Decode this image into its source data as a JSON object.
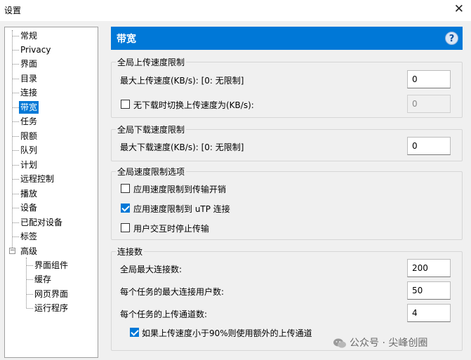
{
  "window": {
    "title": "设置",
    "close_glyph": "✕"
  },
  "tree": {
    "items": [
      {
        "label": "常规"
      },
      {
        "label": "Privacy"
      },
      {
        "label": "界面"
      },
      {
        "label": "目录"
      },
      {
        "label": "连接"
      },
      {
        "label": "带宽",
        "selected": true
      },
      {
        "label": "任务"
      },
      {
        "label": "限额"
      },
      {
        "label": "队列"
      },
      {
        "label": "计划"
      },
      {
        "label": "远程控制"
      },
      {
        "label": "播放"
      },
      {
        "label": "设备"
      },
      {
        "label": "已配对设备"
      },
      {
        "label": "标签"
      },
      {
        "label": "高级"
      }
    ],
    "advanced_children": [
      {
        "label": "界面组件"
      },
      {
        "label": "缓存"
      },
      {
        "label": "网页界面"
      },
      {
        "label": "运行程序"
      }
    ],
    "expander_glyph": "−"
  },
  "header": {
    "title": "带宽",
    "help_glyph": "?"
  },
  "upload_group": {
    "legend": "全局上传速度限制",
    "max_upload_label": "最大上传速度(KB/s): [0: 无限制]",
    "max_upload_value": "0",
    "alt_upload_label": "无下载时切换上传速度为(KB/s):",
    "alt_upload_checked": false,
    "alt_upload_value": "0"
  },
  "download_group": {
    "legend": "全局下载速度限制",
    "max_download_label": "最大下载速度(KB/s): [0: 无限制]",
    "max_download_value": "0"
  },
  "options_group": {
    "legend": "全局速度限制选项",
    "apply_overhead_label": "应用速度限制到传输开销",
    "apply_overhead_checked": false,
    "apply_utp_label": "应用速度限制到 uTP 连接",
    "apply_utp_checked": true,
    "stop_on_interaction_label": "用户交互时停止传输",
    "stop_on_interaction_checked": false
  },
  "connections_group": {
    "legend": "连接数",
    "global_max_label": "全局最大连接数:",
    "global_max_value": "200",
    "per_task_peers_label": "每个任务的最大连接用户数:",
    "per_task_peers_value": "50",
    "per_task_slots_label": "每个任务的上传通道数:",
    "per_task_slots_value": "4",
    "extra_slots_label": "如果上传速度小于90%则使用额外的上传通道",
    "extra_slots_checked": true
  },
  "watermark": {
    "text": "公众号 · 尖峰创圈",
    "icon": "wechat-icon"
  },
  "colors": {
    "accent": "#0078d7",
    "header_text": "#ffffff"
  }
}
